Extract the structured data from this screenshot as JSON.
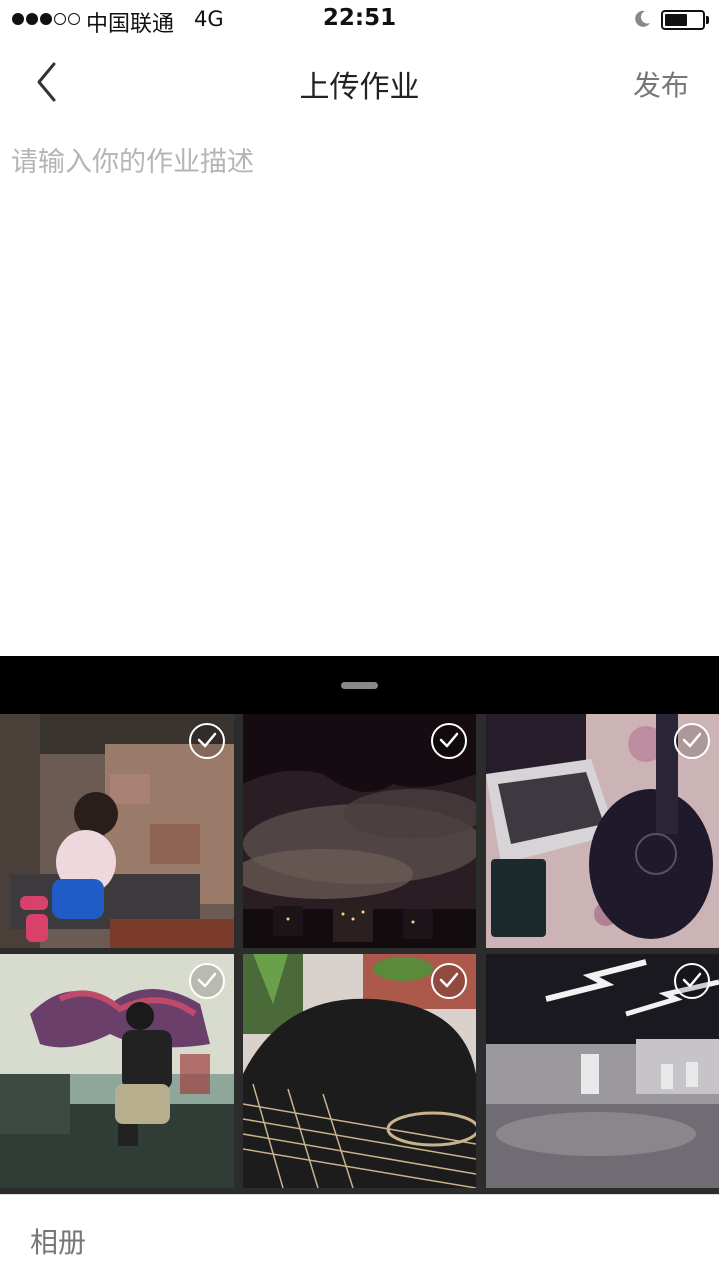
{
  "status_bar": {
    "carrier": "中国联通",
    "network": "4G",
    "time": "22:51",
    "battery_level": 0.6,
    "signal_bars_filled": 3,
    "signal_bars_total": 5
  },
  "nav": {
    "back_icon": "chevron-left-icon",
    "title": "上传作业",
    "publish_label": "发布"
  },
  "description": {
    "placeholder": "请输入你的作业描述",
    "value": ""
  },
  "picker": {
    "photos": [
      {
        "subject": "child-by-wall",
        "selected": true
      },
      {
        "subject": "night-sky-city",
        "selected": true
      },
      {
        "subject": "laptop-and-guitar",
        "selected": true
      },
      {
        "subject": "graffiti-guitarist",
        "selected": true
      },
      {
        "subject": "guitar-closeup",
        "selected": true
      },
      {
        "subject": "office-interior",
        "selected": true
      }
    ],
    "album_label": "相册"
  },
  "colors": {
    "sheet_background": "#000000",
    "grid_gap": "#2c2c2c",
    "muted_text": "#777777",
    "placeholder_text": "#b5b5b5"
  }
}
